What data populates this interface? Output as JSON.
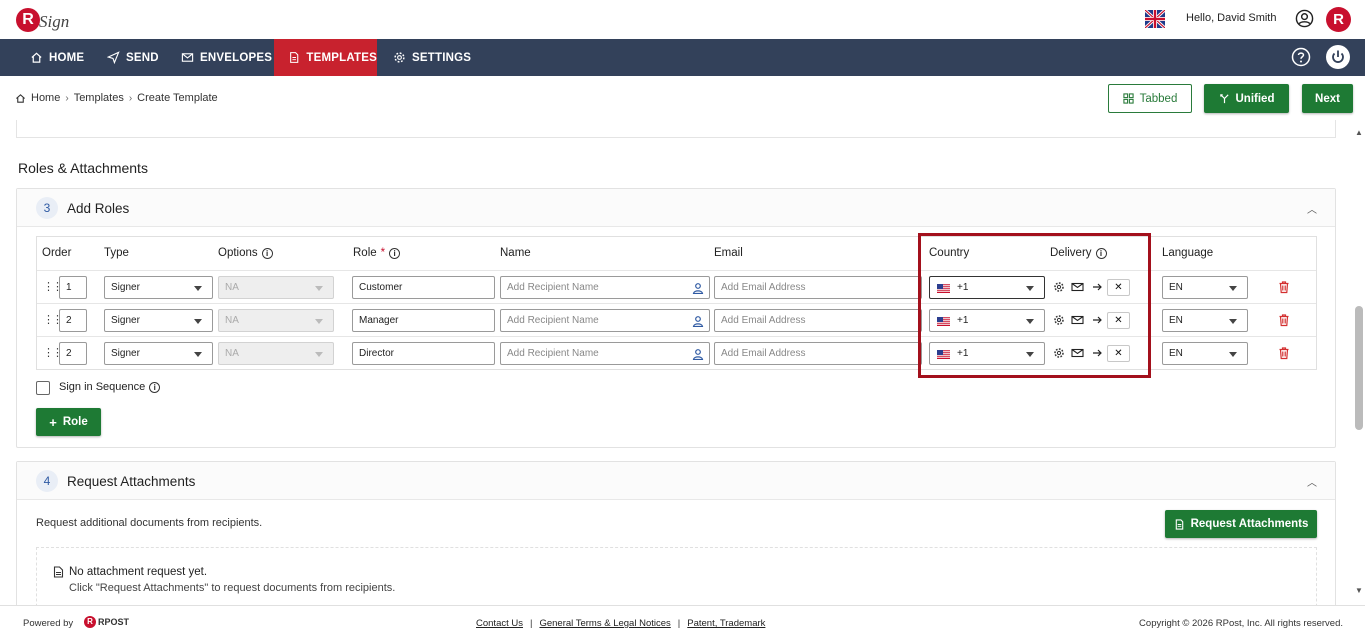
{
  "header": {
    "logo_letter": "R",
    "logo_text": "Sign",
    "greeting": "Hello, David Smith",
    "avatar_letter": "R"
  },
  "nav": {
    "items": [
      {
        "label": "HOME",
        "icon": "home-icon"
      },
      {
        "label": "SEND",
        "icon": "send-icon"
      },
      {
        "label": "ENVELOPES",
        "icon": "envelope-icon"
      },
      {
        "label": "TEMPLATES",
        "icon": "template-icon",
        "active": true
      },
      {
        "label": "SETTINGS",
        "icon": "gear-icon"
      }
    ],
    "active_color": "#c8222e",
    "bar_color": "#33415a"
  },
  "breadcrumb": {
    "items": [
      "Home",
      "Templates",
      "Create Template"
    ]
  },
  "toolbar": {
    "tabbed_label": "Tabbed",
    "unified_label": "Unified",
    "next_label": "Next",
    "accent": "#1e7a34"
  },
  "section_title": "Roles & Attachments",
  "add_roles": {
    "step": "3",
    "title": "Add Roles",
    "columns": {
      "order": "Order",
      "type": "Type",
      "options": "Options",
      "role": "Role",
      "role_required": "*",
      "name": "Name",
      "email": "Email",
      "country": "Country",
      "delivery": "Delivery",
      "language": "Language"
    },
    "rows": [
      {
        "order": "1",
        "type": "Signer",
        "options": "NA",
        "role": "Customer",
        "name_placeholder": "Add Recipient Name",
        "email_placeholder": "Add Email Address",
        "country_code": "+1",
        "language": "EN"
      },
      {
        "order": "2",
        "type": "Signer",
        "options": "NA",
        "role": "Manager",
        "name_placeholder": "Add Recipient Name",
        "email_placeholder": "Add Email Address",
        "country_code": "+1",
        "language": "EN"
      },
      {
        "order": "2",
        "type": "Signer",
        "options": "NA",
        "role": "Director",
        "name_placeholder": "Add Recipient Name",
        "email_placeholder": "Add Email Address",
        "country_code": "+1",
        "language": "EN"
      }
    ],
    "sign_in_sequence_label": "Sign in Sequence",
    "add_role_label": "Role",
    "add_role_prefix": "+"
  },
  "request_attachments": {
    "step": "4",
    "title": "Request Attachments",
    "description": "Request additional documents from recipients.",
    "button_label": "Request Attachments",
    "empty_title": "No attachment request yet.",
    "empty_hint": "Click \"Request Attachments\" to request documents from recipients."
  },
  "footer": {
    "powered_by": "Powered by",
    "brand": "RPOST",
    "links": [
      "Contact Us",
      "General Terms & Legal Notices",
      "Patent, Trademark"
    ],
    "separator": "|",
    "copyright": "Copyright © 2026 RPost, Inc. All rights reserved."
  },
  "highlight_color": "#a3101c"
}
